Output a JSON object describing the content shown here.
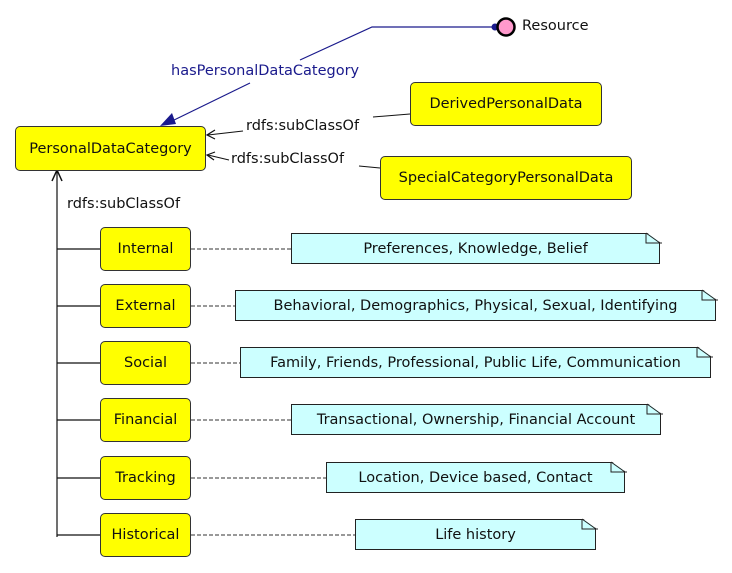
{
  "diagram": {
    "resource": {
      "label": "Resource",
      "fill": "#ff99cc"
    },
    "property": {
      "label": "hasPersonalDataCategory",
      "color": "#1a1a8c"
    },
    "root": {
      "label": "PersonalDataCategory"
    },
    "side_classes": [
      {
        "label": "DerivedPersonalData",
        "relation": "rdfs:subClassOf"
      },
      {
        "label": "SpecialCategoryPersonalData",
        "relation": "rdfs:subClassOf"
      }
    ],
    "subclass_relation_label": "rdfs:subClassOf",
    "categories": [
      {
        "label": "Internal",
        "note": "Preferences, Knowledge, Belief"
      },
      {
        "label": "External",
        "note": "Behavioral, Demographics, Physical, Sexual, Identifying"
      },
      {
        "label": "Social",
        "note": "Family, Friends, Professional, Public Life, Communication"
      },
      {
        "label": "Financial",
        "note": "Transactional, Ownership, Financial Account"
      },
      {
        "label": "Tracking",
        "note": "Location, Device based, Contact"
      },
      {
        "label": "Historical",
        "note": "Life history"
      }
    ],
    "colors": {
      "class_fill": "#ffff00",
      "note_fill": "#ccffff",
      "edge": "#111111"
    }
  }
}
